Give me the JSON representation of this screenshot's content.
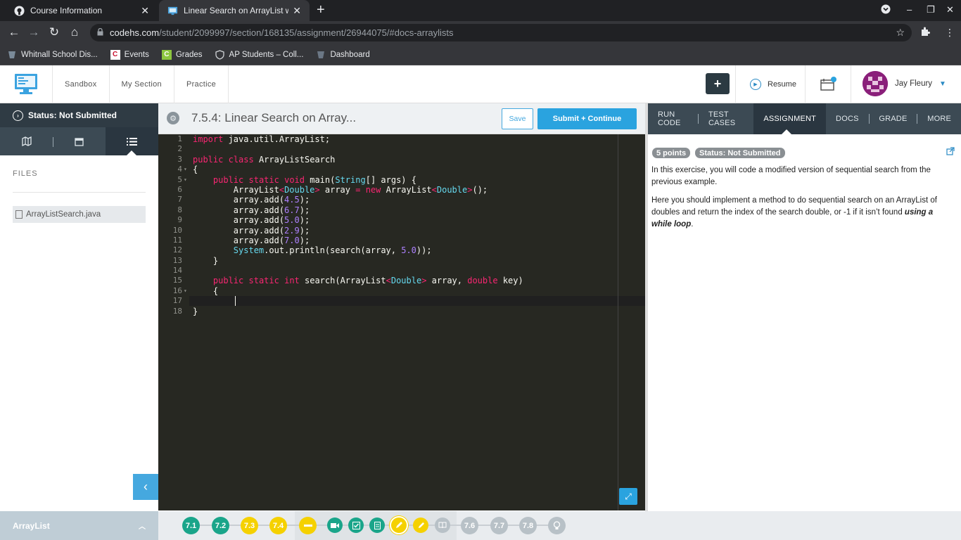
{
  "browser": {
    "tabs": [
      {
        "title": "Course Information",
        "active": false
      },
      {
        "title": "Linear Search on ArrayList with W",
        "active": true
      }
    ],
    "url_host": "codehs.com",
    "url_path": "/student/2099997/section/168135/assignment/26944075/#docs-arraylists",
    "bookmarks": [
      {
        "label": "Whitnall School Dis..."
      },
      {
        "label": "Events"
      },
      {
        "label": "Grades"
      },
      {
        "label": "AP Students – Coll..."
      },
      {
        "label": "Dashboard"
      }
    ]
  },
  "header": {
    "nav": [
      "Sandbox",
      "My Section",
      "Practice"
    ],
    "plus_label": "+",
    "resume_label": "Resume",
    "user_name": "Jay Fleury"
  },
  "sidebar": {
    "status": "Status: Not Submitted",
    "files_label": "FILES",
    "file_name": "ArrayListSearch.java",
    "unit_label": "ArrayList"
  },
  "editor": {
    "title": "7.5.4: Linear Search on Array...",
    "save_label": "Save",
    "submit_label": "Submit + Continue",
    "line_numbers": [
      "1",
      "2",
      "3",
      "4",
      "5",
      "6",
      "7",
      "8",
      "9",
      "10",
      "11",
      "12",
      "13",
      "14",
      "15",
      "16",
      "17",
      "18"
    ]
  },
  "right_panel": {
    "tabs": [
      "RUN CODE",
      "TEST CASES",
      "ASSIGNMENT",
      "DOCS",
      "GRADE",
      "MORE"
    ],
    "selected_tab": "ASSIGNMENT",
    "points_badge": "5 points",
    "status_badge": "Status: Not Submitted",
    "para1": "In this exercise, you will code a modified version of sequential search from the previous example.",
    "para2_plain": "Here you should implement a method to do sequential search on an ArrayList of doubles and return the index of the search double, or -1 if it isn’t found ",
    "para2_emph": "using a while loop",
    "para2_end": "."
  },
  "progress": {
    "items": [
      {
        "label": "7.1",
        "color": "teal"
      },
      {
        "label": "7.2",
        "color": "teal"
      },
      {
        "label": "7.3",
        "color": "yellow"
      },
      {
        "label": "7.4",
        "color": "yellow"
      },
      {
        "label": "7.6",
        "color": "grey"
      },
      {
        "label": "7.7",
        "color": "grey"
      },
      {
        "label": "7.8",
        "color": "grey"
      }
    ]
  },
  "colors": {
    "accent": "#2aa3df",
    "dark": "#2f3b44",
    "teal": "#1aa58a",
    "yellow": "#f5d100"
  }
}
